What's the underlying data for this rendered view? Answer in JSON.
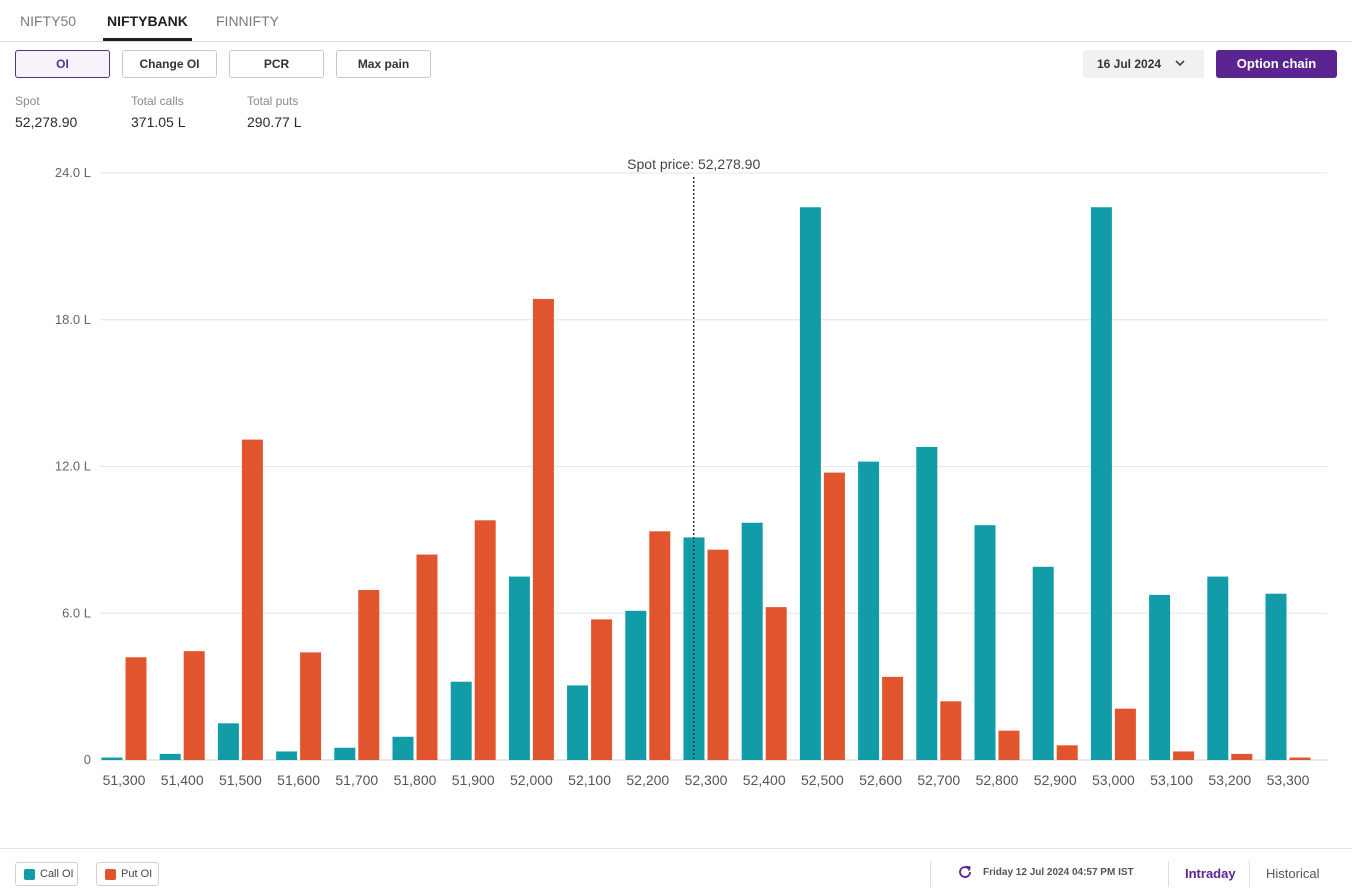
{
  "tabs": [
    {
      "label": "NIFTY50",
      "active": false
    },
    {
      "label": "NIFTYBANK",
      "active": true
    },
    {
      "label": "FINNIFTY",
      "active": false
    }
  ],
  "toolbar": {
    "buttons": [
      {
        "label": "OI",
        "active": true
      },
      {
        "label": "Change OI",
        "active": false
      },
      {
        "label": "PCR",
        "active": false
      },
      {
        "label": "Max pain",
        "active": false
      }
    ],
    "expiry": "16 Jul 2024",
    "option_chain_label": "Option chain"
  },
  "stats": [
    {
      "label": "Spot",
      "value": "52,278.90"
    },
    {
      "label": "Total calls",
      "value": "371.05 L"
    },
    {
      "label": "Total puts",
      "value": "290.77 L"
    }
  ],
  "colors": {
    "call": "#119ca8",
    "put": "#e0552d",
    "accent": "#5b2491"
  },
  "chart_data": {
    "type": "bar",
    "categories": [
      "51,300",
      "51,400",
      "51,500",
      "51,600",
      "51,700",
      "51,800",
      "51,900",
      "52,000",
      "52,100",
      "52,200",
      "52,300",
      "52,400",
      "52,500",
      "52,600",
      "52,700",
      "52,800",
      "52,900",
      "53,000",
      "53,100",
      "53,200",
      "53,300"
    ],
    "strikes": [
      51300,
      51400,
      51500,
      51600,
      51700,
      51800,
      51900,
      52000,
      52100,
      52200,
      52300,
      52400,
      52500,
      52600,
      52700,
      52800,
      52900,
      53000,
      53100,
      53200,
      53300
    ],
    "series": [
      {
        "name": "Call OI",
        "color": "#119ca8",
        "values": [
          0.1,
          0.25,
          1.5,
          0.35,
          0.5,
          0.95,
          3.2,
          7.5,
          3.05,
          6.1,
          9.1,
          9.7,
          22.6,
          12.2,
          12.8,
          9.6,
          7.9,
          22.6,
          6.75,
          7.5,
          6.8
        ]
      },
      {
        "name": "Put OI",
        "color": "#e0552d",
        "values": [
          4.2,
          4.45,
          13.1,
          4.4,
          6.95,
          8.4,
          9.8,
          18.85,
          5.75,
          9.35,
          8.6,
          6.25,
          11.75,
          3.4,
          2.4,
          1.2,
          0.6,
          2.1,
          0.35,
          0.25,
          0.1
        ]
      }
    ],
    "yticks": [
      0,
      6,
      12,
      18,
      24
    ],
    "ytick_labels": [
      "0",
      "6.0 L",
      "12.0 L",
      "18.0 L",
      "24.0 L"
    ],
    "ylim": [
      0,
      24
    ],
    "spot_line": {
      "value": 52278.9,
      "label": "Spot price: 52,278.90"
    },
    "grid": true,
    "legend": "bottom-left"
  },
  "footer": {
    "legend": [
      {
        "label": "Call OI",
        "color": "#119ca8"
      },
      {
        "label": "Put OI",
        "color": "#e0552d"
      }
    ],
    "updated": "Friday 12 Jul 2024 04:57 PM IST",
    "modes": [
      {
        "label": "Intraday",
        "active": true
      },
      {
        "label": "Historical",
        "active": false
      }
    ]
  }
}
